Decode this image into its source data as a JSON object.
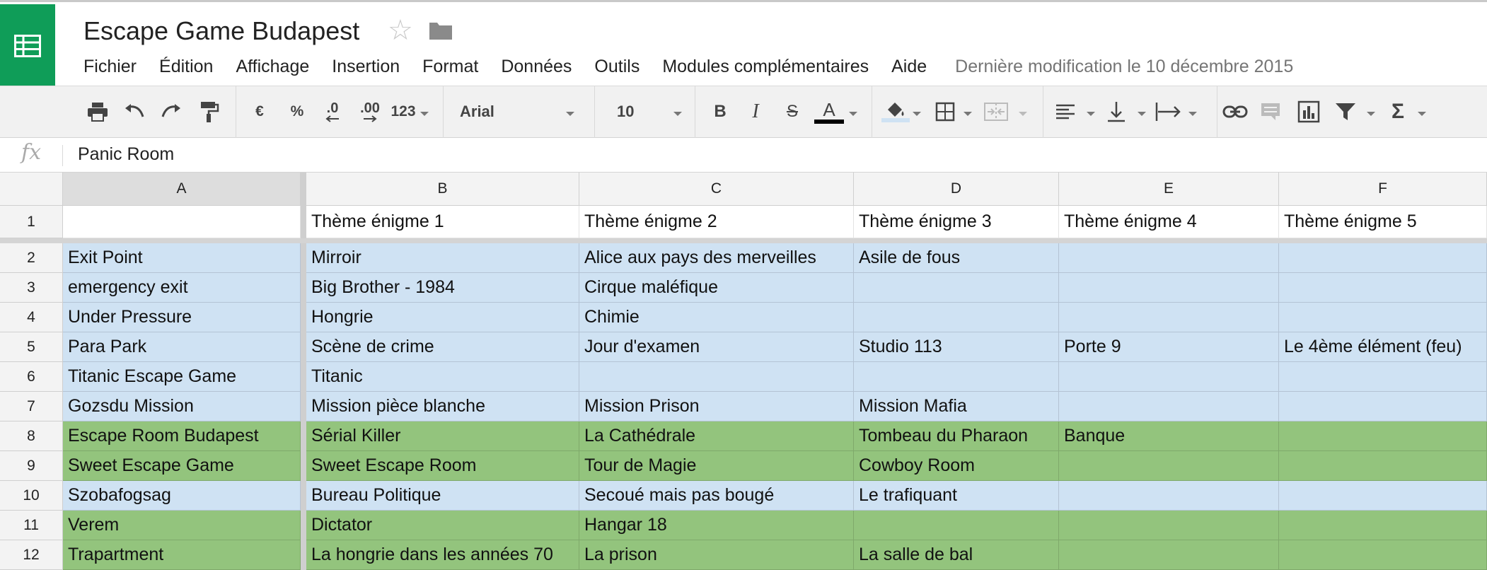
{
  "doc": {
    "title": "Escape Game Budapest",
    "last_edit": "Dernière modification le 10 décembre 2015"
  },
  "menu": [
    "Fichier",
    "Édition",
    "Affichage",
    "Insertion",
    "Format",
    "Données",
    "Outils",
    "Modules complémentaires",
    "Aide"
  ],
  "toolbar": {
    "currency": "€",
    "percent": "%",
    "dec_decrease": ".0",
    "dec_increase": ".00",
    "more_formats": "123",
    "font": "Arial",
    "font_size": "10",
    "bold": "B",
    "italic": "I",
    "strike": "S",
    "text_color": "A",
    "text_color_value": "#000000",
    "sum": "Σ"
  },
  "formula_bar": {
    "icon": "fx",
    "value": "Panic Room"
  },
  "sheet": {
    "columns": [
      "A",
      "B",
      "C",
      "D",
      "E",
      "F"
    ],
    "selected_column": "A",
    "rows": [
      {
        "num": "1",
        "color": "white",
        "cells": [
          "",
          "Thème énigme 1",
          "Thème énigme 2",
          "Thème énigme 3",
          "Thème énigme 4",
          "Thème énigme 5"
        ]
      },
      {
        "num": "2",
        "color": "blue",
        "cells": [
          "Exit Point",
          "Mirroir",
          "Alice aux pays des merveilles",
          "Asile de fous",
          "",
          ""
        ]
      },
      {
        "num": "3",
        "color": "blue",
        "cells": [
          "emergency exit",
          "Big Brother - 1984",
          "Cirque maléfique",
          "",
          "",
          ""
        ]
      },
      {
        "num": "4",
        "color": "blue",
        "cells": [
          "Under Pressure",
          "Hongrie",
          "Chimie",
          "",
          "",
          ""
        ]
      },
      {
        "num": "5",
        "color": "blue",
        "cells": [
          "Para Park",
          "Scène de crime",
          "Jour d'examen",
          "Studio 113",
          "Porte 9",
          "Le 4ème élément (feu)"
        ]
      },
      {
        "num": "6",
        "color": "blue",
        "cells": [
          "Titanic Escape Game",
          "Titanic",
          "",
          "",
          "",
          ""
        ]
      },
      {
        "num": "7",
        "color": "blue",
        "cells": [
          "Gozsdu Mission",
          "Mission pièce blanche",
          "Mission Prison",
          "Mission Mafia",
          "",
          ""
        ]
      },
      {
        "num": "8",
        "color": "green",
        "cells": [
          "Escape Room Budapest",
          "Sérial Killer",
          "La Cathédrale",
          "Tombeau du Pharaon",
          "Banque",
          ""
        ]
      },
      {
        "num": "9",
        "color": "green",
        "cells": [
          "Sweet Escape Game",
          "Sweet Escape Room",
          "Tour de Magie",
          "Cowboy Room",
          "",
          ""
        ]
      },
      {
        "num": "10",
        "color": "blue",
        "cells": [
          "Szobafogsag",
          "Bureau Politique",
          "Secoué mais pas bougé",
          "Le trafiquant",
          "",
          ""
        ]
      },
      {
        "num": "11",
        "color": "green",
        "cells": [
          "Verem",
          "Dictator",
          "Hangar 18",
          "",
          "",
          ""
        ]
      },
      {
        "num": "12",
        "color": "green",
        "cells": [
          "Trapartment",
          "La hongrie dans les années 70",
          "La prison",
          "La salle de bal",
          "",
          ""
        ]
      }
    ]
  },
  "colors": {
    "brand_green": "#0f9d58",
    "row_blue": "#cfe2f3",
    "row_green": "#93c47d"
  },
  "icons": [
    "sheets-logo-icon",
    "star-icon",
    "folder-icon",
    "print-icon",
    "undo-icon",
    "redo-icon",
    "paint-format-icon",
    "fill-color-icon",
    "borders-icon",
    "merge-cells-icon",
    "align-left-icon",
    "valign-bottom-icon",
    "text-wrap-icon",
    "link-icon",
    "comment-icon",
    "chart-icon",
    "filter-icon",
    "sum-icon"
  ]
}
